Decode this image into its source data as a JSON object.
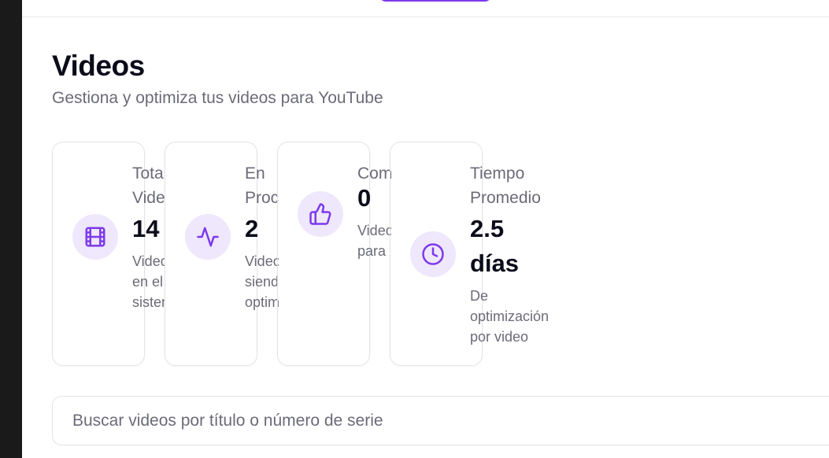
{
  "header": {
    "title": "Videos",
    "subtitle": "Gestiona y optimiza tus videos para YouTube"
  },
  "stats": [
    {
      "label": "Total Videos",
      "value": "14",
      "description": "Videos en el sistema",
      "icon": "film-icon"
    },
    {
      "label": "En Proceso",
      "value": "2",
      "description": "Videos siendo optimizados",
      "icon": "activity-icon"
    },
    {
      "label": "Completados",
      "value": "0",
      "description": "Videos para",
      "icon": "thumbs-up-icon"
    },
    {
      "label": "Tiempo Promedio",
      "value": "2.5 días",
      "description": "De optimización por video",
      "icon": "clock-icon"
    }
  ],
  "search": {
    "placeholder": "Buscar videos por título o número de serie",
    "value": ""
  },
  "colors": {
    "accent": "#7c3aed",
    "icon_bg": "#efe7fb",
    "muted_text": "#6b6b78",
    "border": "#e3e3e8"
  }
}
